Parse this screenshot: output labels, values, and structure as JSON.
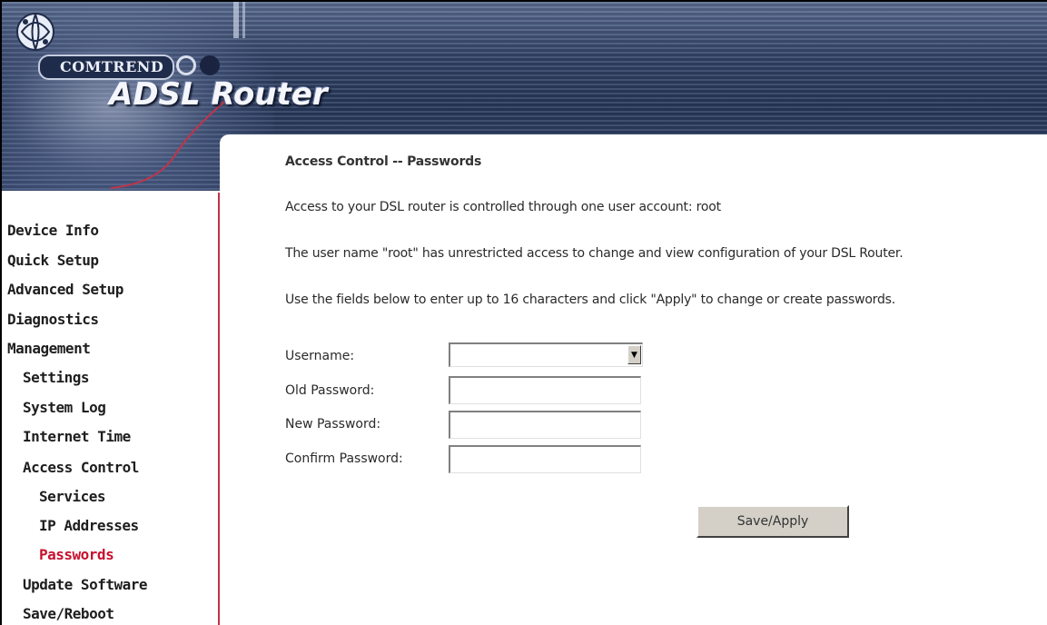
{
  "brand": {
    "company": "COMTREND",
    "product": "ADSL Router"
  },
  "sidebar": {
    "items": [
      {
        "label": "Device Info"
      },
      {
        "label": "Quick Setup"
      },
      {
        "label": "Advanced Setup"
      },
      {
        "label": "Diagnostics"
      },
      {
        "label": "Management"
      },
      {
        "label": "Settings"
      },
      {
        "label": "System Log"
      },
      {
        "label": "Internet Time"
      },
      {
        "label": "Access Control"
      },
      {
        "label": "Services"
      },
      {
        "label": "IP Addresses"
      },
      {
        "label": "Passwords"
      },
      {
        "label": "Update Software"
      },
      {
        "label": "Save/Reboot"
      }
    ],
    "active": "Passwords",
    "active_color": "#c8102e"
  },
  "main": {
    "title": "Access Control -- Passwords",
    "line1": "Access to your DSL router is controlled through one user account: root",
    "line2": "The user name \"root\" has unrestricted access to change and view configuration of your DSL Router.",
    "line3": "Use the fields below to enter up to 16 characters and click \"Apply\" to change or create passwords.",
    "form": {
      "username_label": "Username:",
      "username_value": "",
      "old_password_label": "Old Password:",
      "old_password_value": "",
      "new_password_label": "New Password:",
      "new_password_value": "",
      "confirm_password_label": "Confirm Password:",
      "confirm_password_value": ""
    },
    "save_label": "Save/Apply"
  },
  "colors": {
    "banner": "#324266",
    "sidebar_border": "#c0344a"
  }
}
